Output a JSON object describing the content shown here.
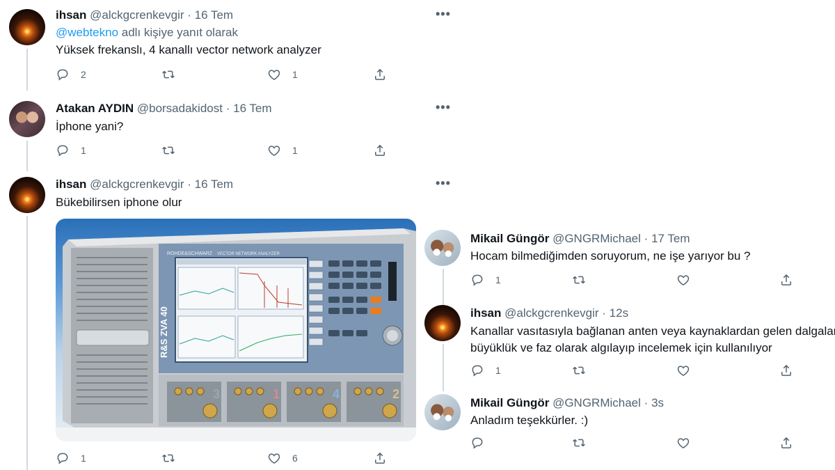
{
  "left_thread": [
    {
      "name": "ihsan",
      "handle": "@alckgcrenkevgir",
      "time": "16 Tem",
      "reply_prefix_mention": "@webtekno",
      "reply_suffix": "adlı kişiye yanıt olarak",
      "text": "Yüksek frekanslı, 4 kanallı vector network analyzer",
      "replies": "2",
      "retweets": "",
      "likes": "1"
    },
    {
      "name": "Atakan AYDIN",
      "handle": "@borsadakidost",
      "time": "16 Tem",
      "text": "İphone yani?",
      "replies": "1",
      "retweets": "",
      "likes": "1"
    },
    {
      "name": "ihsan",
      "handle": "@alckgcrenkevgir",
      "time": "16 Tem",
      "text": "Bükebilirsen iphone olur",
      "replies": "1",
      "retweets": "",
      "likes": "6",
      "media": {
        "panel_brand": "ROHDE&SCHWARZ",
        "panel_model": "ZVA 40",
        "panel_model_vertical": "R&S ZVA 40",
        "panel_subtitle": "VECTOR NETWORK ANALYZER",
        "port_numbers": [
          "3",
          "1",
          "4",
          "2"
        ]
      }
    }
  ],
  "right_thread": [
    {
      "name": "Mikail Güngör",
      "handle": "@GNGRMichael",
      "time": "17 Tem",
      "text": "Hocam bilmediğimden soruyorum, ne işe yarıyor bu ?",
      "replies": "1",
      "retweets": "",
      "likes": ""
    },
    {
      "name": "ihsan",
      "handle": "@alckgcrenkevgir",
      "time": "12s",
      "text_line1": "Kanallar vasıtasıyla bağlanan anten veya kaynaklardan gelen dalgaları",
      "text_line2": "büyüklük ve faz olarak algılayıp incelemek için kullanılıyor",
      "replies": "1",
      "retweets": "",
      "likes": ""
    },
    {
      "name": "Mikail Güngör",
      "handle": "@GNGRMichael",
      "time": "3s",
      "text": "Anladım teşekkürler. :)",
      "replies": "",
      "retweets": "",
      "likes": ""
    }
  ],
  "ui": {
    "dot_separator": "·",
    "more_glyph": "•••",
    "icons": [
      "reply-icon",
      "retweet-icon",
      "like-icon",
      "share-icon",
      "more-icon"
    ],
    "colors": {
      "mention": "#1d9bf0",
      "secondary": "#536471",
      "thread_line": "#cfd9de"
    }
  }
}
